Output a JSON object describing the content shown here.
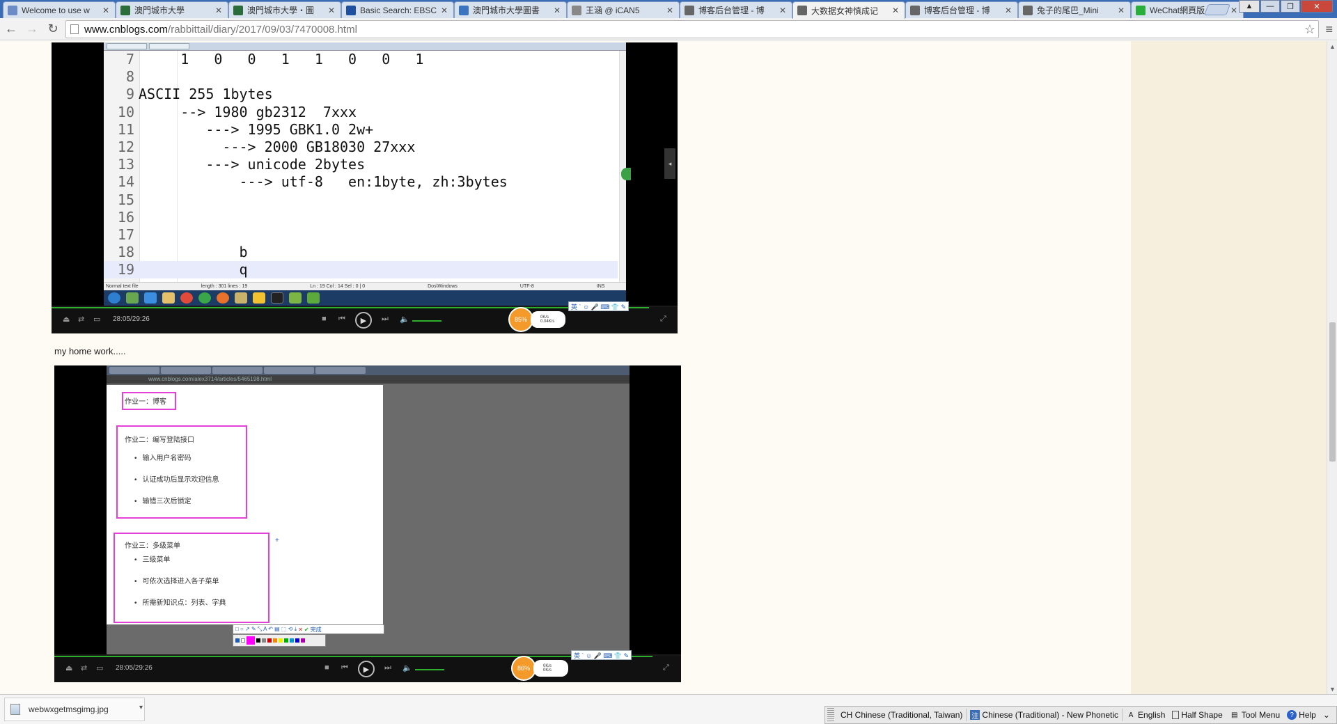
{
  "browser": {
    "tabs": [
      {
        "title": "Welcome to use w",
        "favicon": "page-icon",
        "color": "#6b8cc7"
      },
      {
        "title": "澳門城市大學",
        "favicon": "cityu-logo",
        "color": "#2a6c3a"
      },
      {
        "title": "澳門城市大學・圖",
        "favicon": "cityu-logo",
        "color": "#2a6c3a"
      },
      {
        "title": "Basic Search: EBSC",
        "favicon": "ebsco-logo",
        "color": "#1f4fa0"
      },
      {
        "title": "澳門城市大學圖書",
        "favicon": "library-logo",
        "color": "#3b75c0"
      },
      {
        "title": "王涵 @ iCAN5",
        "favicon": "page-icon",
        "color": "#888888"
      },
      {
        "title": "博客后台管理 - 博",
        "favicon": "cnblogs-logo",
        "color": "#666666"
      },
      {
        "title": "大数据女神慎成记",
        "favicon": "cnblogs-logo",
        "color": "#666666",
        "active": true
      },
      {
        "title": "博客后台管理 - 博",
        "favicon": "cnblogs-logo",
        "color": "#666666"
      },
      {
        "title": "兔子的尾巴_Mini",
        "favicon": "cnblogs-logo",
        "color": "#666666"
      },
      {
        "title": "WeChat網頁版",
        "favicon": "wechat-logo",
        "color": "#2aae3a"
      }
    ],
    "url_host": "www.cnblogs.com",
    "url_path": "/rabbittail/diary/2017/09/03/7470008.html"
  },
  "video1": {
    "code_lines": [
      {
        "n": "7",
        "text": "     1   0   0   1   1   0   0   1"
      },
      {
        "n": "8",
        "text": ""
      },
      {
        "n": "9",
        "text": "ASCII 255 1bytes"
      },
      {
        "n": "10",
        "text": "     --> 1980 gb2312  7xxx"
      },
      {
        "n": "11",
        "text": "        ---> 1995 GBK1.0 2w+"
      },
      {
        "n": "12",
        "text": "          ---> 2000 GB18030 27xxx"
      },
      {
        "n": "13",
        "text": "        ---> unicode 2bytes"
      },
      {
        "n": "14",
        "text": "            ---> utf-8   en:1byte, zh:3bytes"
      },
      {
        "n": "15",
        "text": ""
      },
      {
        "n": "16",
        "text": ""
      },
      {
        "n": "17",
        "text": ""
      },
      {
        "n": "18",
        "text": "            b"
      },
      {
        "n": "19",
        "text": "            q",
        "current": true
      }
    ],
    "status": [
      "Normal text file",
      "length : 301    lines : 19",
      "Ln : 19    Col : 14    Sel : 0 | 0",
      "Dos\\Windows",
      "UTF-8",
      "INS"
    ],
    "time": "28:05/29:26",
    "played_fraction": 0.954,
    "speed": "85%",
    "net_up": "0K/s",
    "net_down": "0.04K/s"
  },
  "caption": "my home work.....",
  "video2": {
    "url": "www.cnblogs.com/alex3714/articles/5465198.html",
    "hw1_title": "作业一：博客",
    "hw2_title": "作业二：编写登陆接口",
    "hw2_items": [
      "输入用户名密码",
      "认证成功后显示欢迎信息",
      "输错三次后锁定"
    ],
    "hw3_title": "作业三：多级菜单",
    "hw3_items": [
      "三级菜单",
      "可依次选择进入各子菜单",
      "所需新知识点：列表、字典"
    ],
    "done_label": "完成",
    "time": "28:05/29:26",
    "played_fraction": 0.954,
    "speed": "86%",
    "net_up": "0K/s",
    "net_down": "0K/s"
  },
  "download": {
    "filename": "webwxgetmsgimg.jpg"
  },
  "langbar": {
    "lang": "CH Chinese (Traditional, Taiwan)",
    "ime": "Chinese (Traditional) - New Phonetic",
    "mode": "English",
    "shape": "Half Shape",
    "tool_menu": "Tool Menu",
    "help": "Help"
  }
}
